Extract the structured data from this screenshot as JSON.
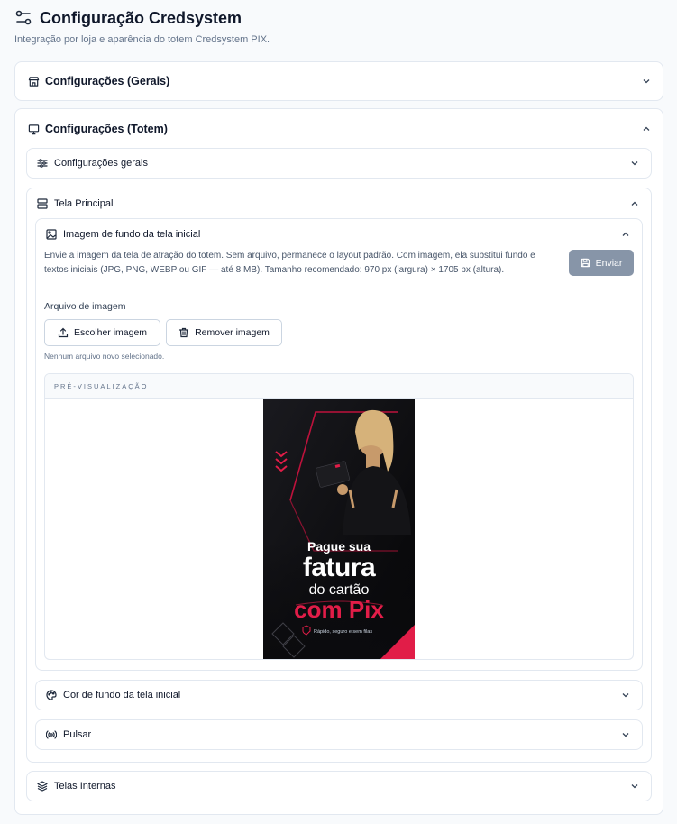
{
  "header": {
    "title": "Configuração Credsystem",
    "subtitle": "Integração por loja e aparência do totem Credsystem PIX."
  },
  "sections": {
    "gerais": "Configurações (Gerais)",
    "totem": "Configurações (Totem)",
    "config_gerais": "Configurações gerais",
    "tela_principal": "Tela Principal",
    "imagem_fundo": "Imagem de fundo da tela inicial",
    "cor_fundo": "Cor de fundo da tela inicial",
    "pulsar": "Pulsar",
    "telas_internas": "Telas Internas"
  },
  "upload": {
    "description": "Envie a imagem da tela de atração do totem. Sem arquivo, permanece o layout padrão. Com imagem, ela substitui fundo e textos iniciais (JPG, PNG, WEBP ou GIF — até 8 MB). Tamanho recomendado: 970 px (largura) × 1705 px (altura).",
    "send_label": "Enviar",
    "field_label": "Arquivo de imagem",
    "choose_label": "Escolher imagem",
    "remove_label": "Remover imagem",
    "hint": "Nenhum arquivo novo selecionado.",
    "preview_label": "PRÉ-VISUALIZAÇÃO"
  },
  "poster": {
    "line1": "Pague sua",
    "line2": "fatura",
    "line3": "do cartão",
    "line4": "com Pix",
    "footer": "Rápido, seguro e sem filas"
  },
  "colors": {
    "accent_red": "#e11d48",
    "send_button": "#8795a8"
  }
}
